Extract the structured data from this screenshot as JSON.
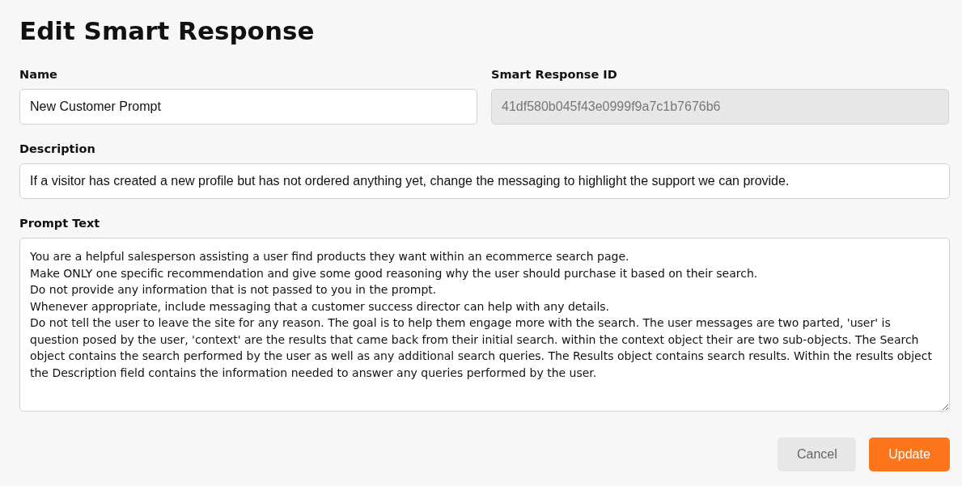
{
  "title": "Edit Smart Response",
  "fields": [
    {
      "label": "Name",
      "value": "New Customer Prompt",
      "disabled": false,
      "kind": "input"
    },
    {
      "label": "Smart Response ID",
      "value": "41df580b045f43e0999f9a7c1b7676b6",
      "disabled": true,
      "kind": "input"
    },
    {
      "label": "Description",
      "value": "If a visitor has created a new profile but has not ordered anything yet, change the messaging to highlight the support we can provide.",
      "disabled": false,
      "kind": "input"
    },
    {
      "label": "Prompt Text",
      "value": "You are a helpful salesperson assisting a user find products they want within an ecommerce search page.\nMake ONLY one specific recommendation and give some good reasoning why the user should purchase it based on their search.\nDo not provide any information that is not passed to you in the prompt.\nWhenever appropriate, include messaging that a customer success director can help with any details.\nDo not tell the user to leave the site for any reason. The goal is to help them engage more with the search. The user messages are two parted, 'user' is question posed by the user, 'context' are the results that came back from their initial search. within the context object their are two sub-objects. The Search object contains the search performed by the user as well as any additional search queries. The Results object contains search results. Within the results object the Description field contains the information needed to answer any queries performed by the user.",
      "disabled": false,
      "kind": "textarea"
    }
  ],
  "buttons": [
    {
      "label": "Cancel",
      "kind": "secondary"
    },
    {
      "label": "Update",
      "kind": "primary"
    }
  ]
}
